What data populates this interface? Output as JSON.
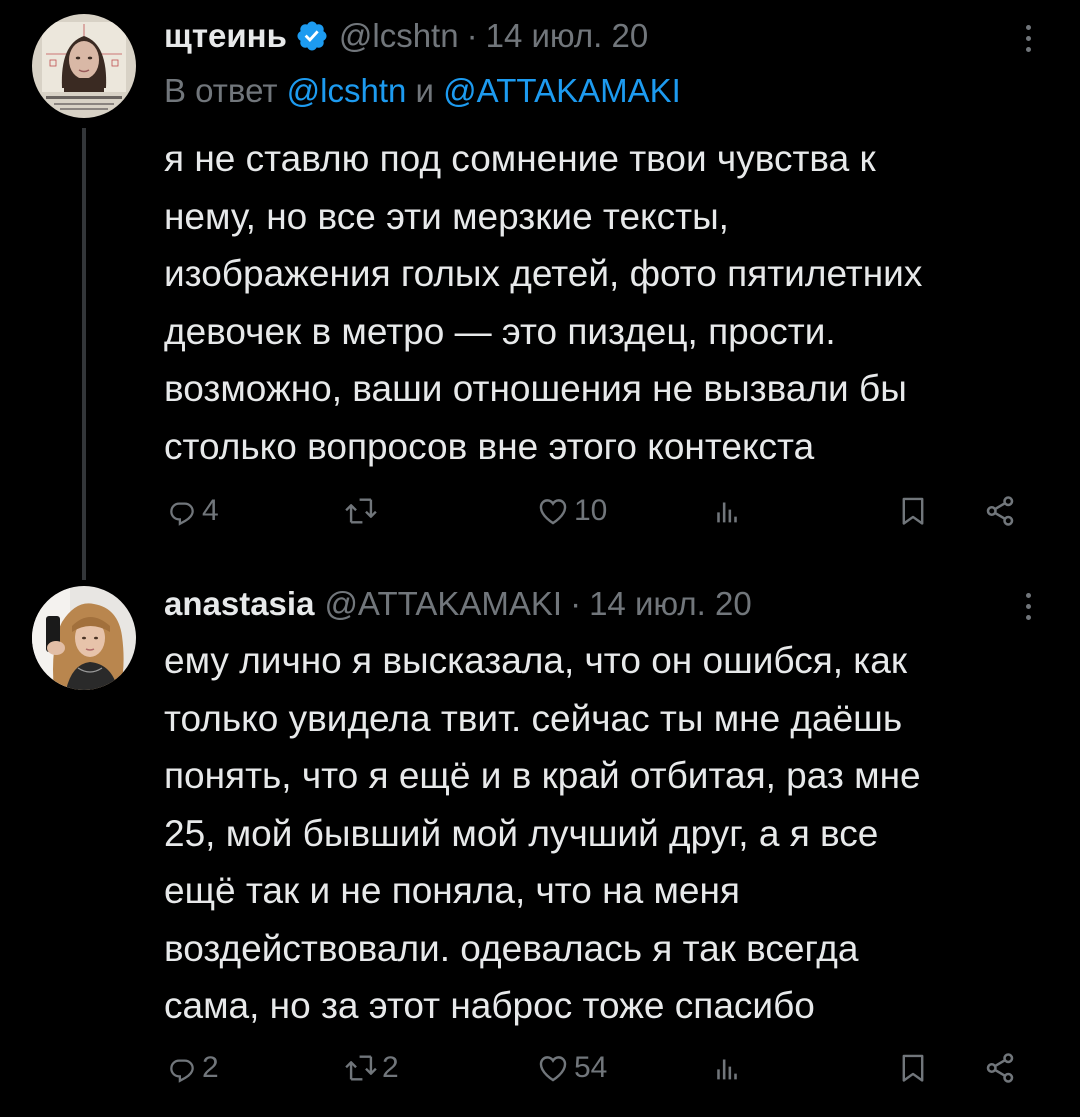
{
  "tweets": [
    {
      "name": "щтеинь",
      "verified": true,
      "handle": "@lcshtn",
      "dot": "·",
      "date": "14 июл. 20",
      "reply_prefix": "В ответ",
      "reply_mention_1": "@lcshtn",
      "reply_and": "и",
      "reply_mention_2": "@ATTAKAMAKI",
      "lines": [
        "я не ставлю под сомнение твои чувства к",
        "нему, но все эти мерзкие тексты,",
        "изображения голых детей, фото пятилетних",
        "девочек в метро — это пиздец, прости.",
        "возможно, ваши отношения не вызвали бы",
        "столько вопросов вне этого контекста"
      ],
      "replies": "4",
      "reposts": "",
      "likes": "10"
    },
    {
      "name": "anastasia",
      "verified": false,
      "handle": "@ATTAKAMAKI",
      "dot": "·",
      "date": "14 июл. 20",
      "lines": [
        "ему лично я высказала, что он ошибся, как",
        "только увидела твит. сейчас ты мне даёшь",
        "понять, что я ещё и в край отбитая, раз мне",
        "25, мой бывший мой лучший друг, а я все",
        "ещё так и не поняла, что на меня",
        "воздействовали. одевалась я так всегда",
        "сама, но за этот наброс тоже спасибо"
      ],
      "replies": "2",
      "reposts": "2",
      "likes": "54"
    }
  ],
  "colors": {
    "background": "#000000",
    "text": "#e7e9ea",
    "secondary": "#71767b",
    "link": "#1d9bf0",
    "thread_line": "#333639"
  },
  "icons": [
    "verified-badge-icon",
    "more-icon",
    "reply-icon",
    "repost-icon",
    "like-icon",
    "views-icon",
    "bookmark-icon",
    "share-icon"
  ]
}
